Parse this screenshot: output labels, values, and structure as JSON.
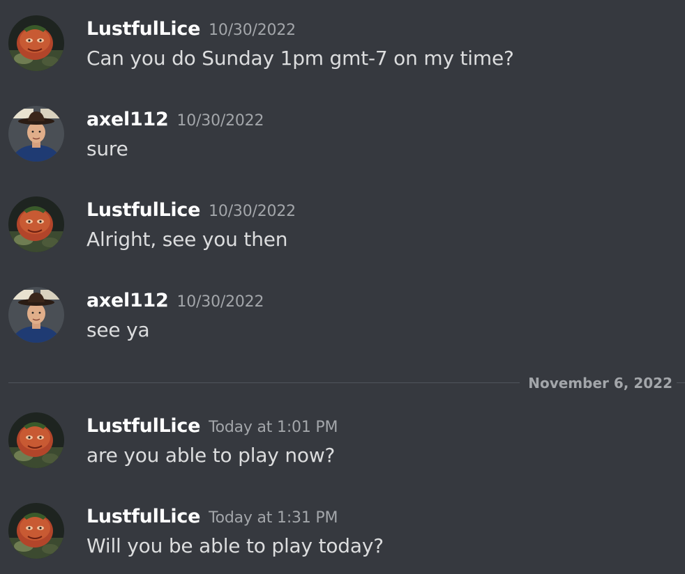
{
  "messages": [
    {
      "author": "LustfulLice",
      "timestamp": "10/30/2022",
      "text": "Can you do Sunday 1pm gmt-7 on my time?",
      "avatar": "tomato-avatar-icon"
    },
    {
      "author": "axel112",
      "timestamp": "10/30/2022",
      "text": "sure",
      "avatar": "cowboy-avatar-icon"
    },
    {
      "author": "LustfulLice",
      "timestamp": "10/30/2022",
      "text": "Alright, see you then",
      "avatar": "tomato-avatar-icon"
    },
    {
      "author": "axel112",
      "timestamp": "10/30/2022",
      "text": "see ya",
      "avatar": "cowboy-avatar-icon"
    },
    {
      "author": "LustfulLice",
      "timestamp": "Today at 1:01 PM",
      "text": "are you able to play now?",
      "avatar": "tomato-avatar-icon"
    },
    {
      "author": "LustfulLice",
      "timestamp": "Today at 1:31 PM",
      "text": "Will you be able to play today?",
      "avatar": "tomato-avatar-icon"
    }
  ],
  "date_divider": {
    "label": "November 6, 2022"
  },
  "colors": {
    "background": "#36393f",
    "author": "#ffffff",
    "message_text": "#dcddde",
    "timestamp": "#a3a6aa",
    "divider": "#4f545c"
  }
}
